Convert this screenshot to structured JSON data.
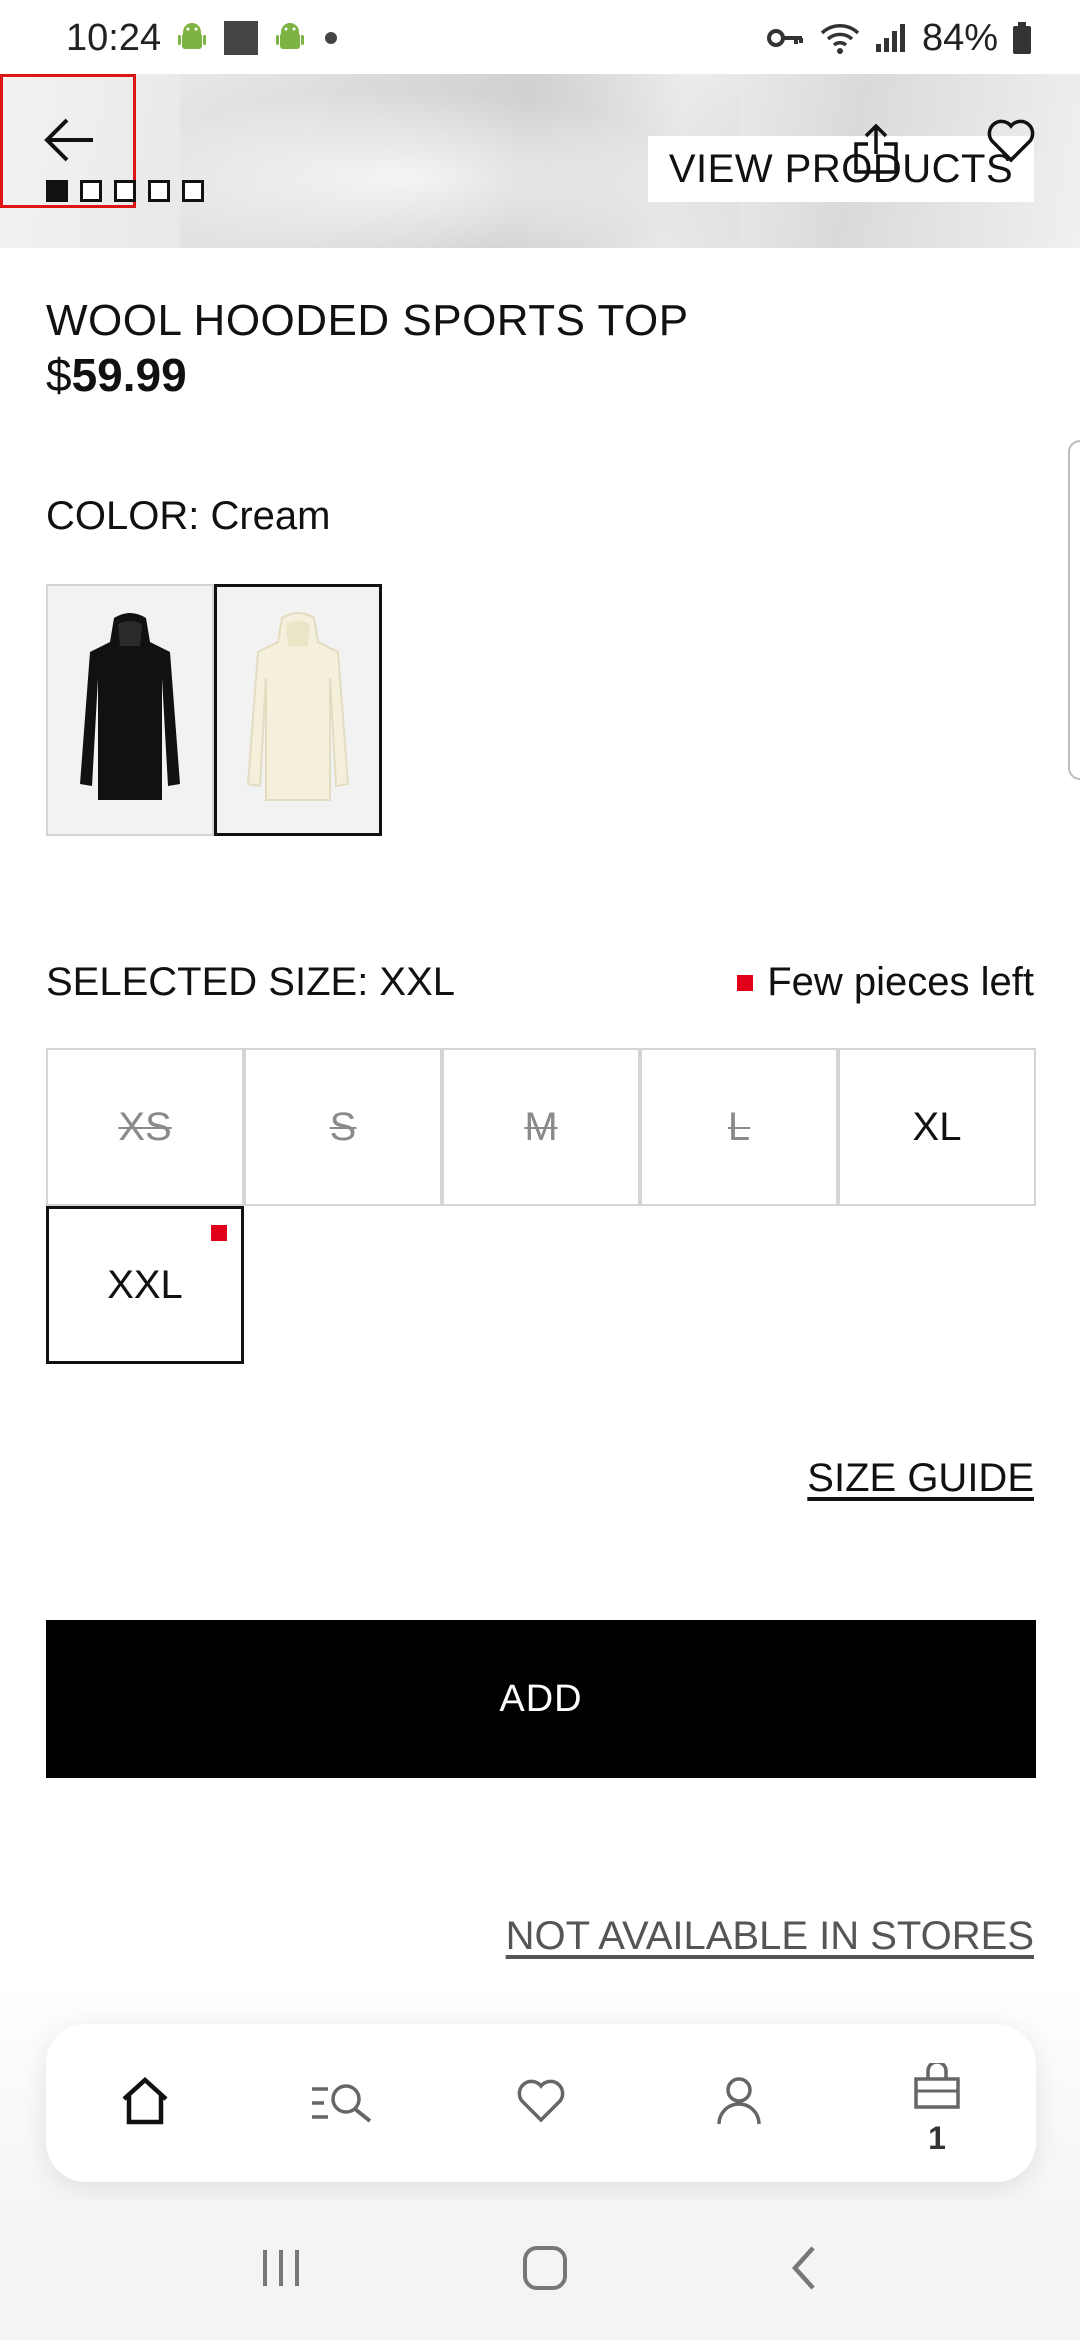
{
  "status_bar": {
    "time": "10:24",
    "battery": "84%"
  },
  "hero": {
    "view_products_label": "VIEW PRODUCTS",
    "image_count": 5,
    "active_image": 1
  },
  "product": {
    "title": "WOOL HOODED SPORTS TOP",
    "currency": "$",
    "price": "59.99"
  },
  "color": {
    "label": "COLOR: Cream",
    "options": [
      {
        "name": "Black",
        "selected": false
      },
      {
        "name": "Cream",
        "selected": true
      }
    ]
  },
  "size": {
    "label": "SELECTED SIZE: XXL",
    "stock_note": "Few pieces left",
    "options": [
      {
        "label": "XS",
        "available": false
      },
      {
        "label": "S",
        "available": false
      },
      {
        "label": "M",
        "available": false
      },
      {
        "label": "L",
        "available": false
      },
      {
        "label": "XL",
        "available": true
      },
      {
        "label": "XXL",
        "available": true,
        "selected": true,
        "low_stock": true
      }
    ],
    "guide_label": "SIZE GUIDE"
  },
  "actions": {
    "add_label": "ADD",
    "store_note": "NOT AVAILABLE IN STORES"
  },
  "tab_bar": {
    "items": [
      "home-icon",
      "search-icon",
      "favorites-icon",
      "account-icon",
      "cart-icon"
    ],
    "cart_count": "1"
  },
  "colors": {
    "accent_red": "#e0001a",
    "primary": "#000000"
  }
}
